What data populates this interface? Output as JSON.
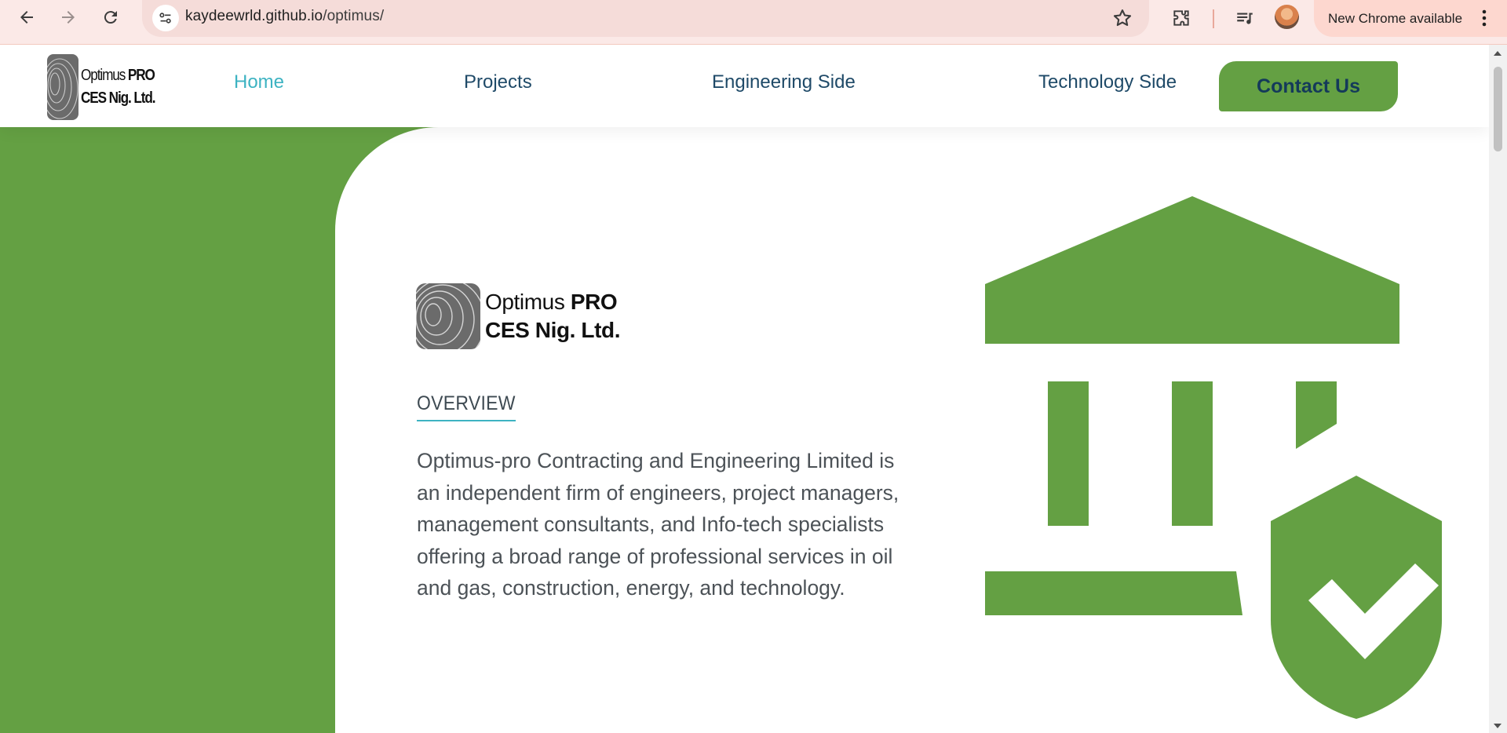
{
  "browser": {
    "url_host": "kaydeewrld.github.io",
    "url_path": "/optimus/",
    "update_label": "New Chrome available"
  },
  "navbar": {
    "logo": {
      "line1_light": "Optimus ",
      "line1_bold": "PRO",
      "line2": "CES Nig. Ltd."
    },
    "links": [
      "Home",
      "Projects",
      "Engineering Side",
      "Technology Side"
    ],
    "active": "Home",
    "cta_label": "Contact Us"
  },
  "hero": {
    "logo": {
      "line1_light": "Optimus ",
      "line1_bold": "PRO",
      "line2": "CES Nig. Ltd."
    },
    "section_label": "OVERVIEW",
    "description": "Optimus-pro Contracting and Engineering Limited is an independent firm of engineers, project managers, management consultants, and Info-tech specialists offering a broad range of professional services in oil and gas, construction, energy, and technology.",
    "illustration_icon": "bank-shield-check-icon"
  },
  "colors": {
    "brand_green": "#64a043",
    "accent_teal": "#3db3c2",
    "nav_text": "#1f4a68",
    "chrome_bg": "#fbe9e7"
  }
}
